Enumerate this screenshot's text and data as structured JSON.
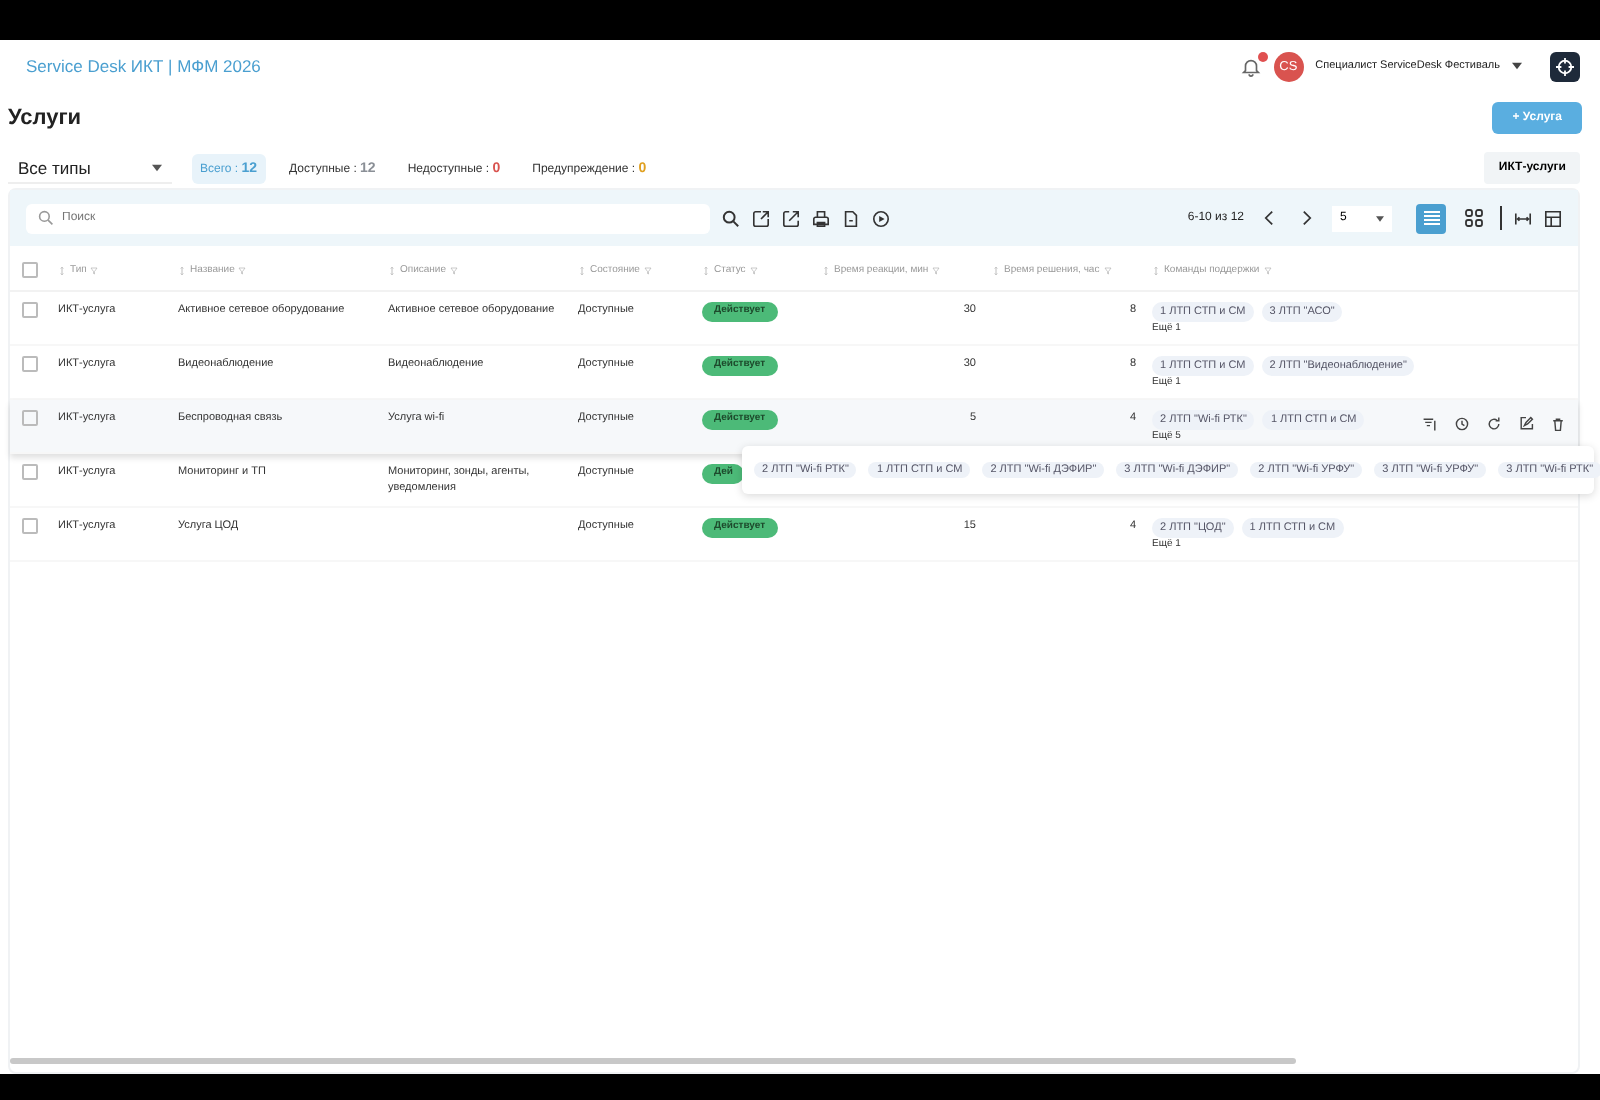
{
  "header": {
    "title": "Service Desk ИКТ | МФМ 2026",
    "notifications": {
      "unread": true
    },
    "user": {
      "initials": "CS",
      "name": "Специалист ServiceDesk Фестиваль"
    }
  },
  "page": {
    "title": "Услуги",
    "add_button": "+ Услуга"
  },
  "filters": {
    "type_select": "Все типы",
    "counters": [
      {
        "label": "Всего :",
        "value": "12",
        "selected": true,
        "color": "#4a9fd0"
      },
      {
        "label": "Доступные :",
        "value": "12",
        "selected": false,
        "color": "#8a8f96"
      },
      {
        "label": "Недоступные :",
        "value": "0",
        "selected": false,
        "color": "#d9534f"
      },
      {
        "label": "Предупреждение :",
        "value": "0",
        "selected": false,
        "color": "#e0a020"
      }
    ]
  },
  "side_tab": "ИКТ-услуги",
  "toolbar": {
    "search_placeholder": "Поиск",
    "range": "6-10 из 12",
    "page_size": "5",
    "views": [
      {
        "kind": "list",
        "selected": true
      },
      {
        "kind": "grid",
        "selected": false
      }
    ]
  },
  "select_all": {
    "checked": false
  },
  "columns": [
    "Тип",
    "Название",
    "Описание",
    "Состояние",
    "Статус",
    "Время реакции, мин",
    "Время решения, час",
    "Команды поддержки"
  ],
  "rows": [
    {
      "checked": false,
      "highlighted": false,
      "type": "ИКТ-услуга",
      "name": "Активное сетевое оборудование",
      "description": "Активное сетевое оборудование",
      "state": "Доступные",
      "status": "Действует",
      "reaction": "30",
      "resolution": "8",
      "teams": [
        "1 ЛТП СТП и СМ",
        "3 ЛТП \"АСО\""
      ],
      "more": "Ещё 1"
    },
    {
      "checked": false,
      "highlighted": false,
      "type": "ИКТ-услуга",
      "name": "Видеонаблюдение",
      "description": "Видеонаблюдение",
      "state": "Доступные",
      "status": "Действует",
      "reaction": "30",
      "resolution": "8",
      "teams": [
        "1 ЛТП СТП и СМ",
        "2 ЛТП \"Видеонаблюдение\""
      ],
      "more": "Ещё 1"
    },
    {
      "checked": false,
      "highlighted": true,
      "type": "ИКТ-услуга",
      "name": "Беспроводная связь",
      "description": "Услуга wi-fi",
      "state": "Доступные",
      "status": "Действует",
      "reaction": "5",
      "resolution": "4",
      "teams": [
        "2 ЛТП \"Wi-fi РТК\"",
        "1 ЛТП СТП и СМ"
      ],
      "more": "Ещё 5"
    },
    {
      "checked": false,
      "highlighted": false,
      "type": "ИКТ-услуга",
      "name": "Мониторинг и ТП",
      "description": "Мониторинг, зонды, агенты, уведомления",
      "state": "Доступные",
      "status": "Дей"
    },
    {
      "checked": false,
      "highlighted": false,
      "type": "ИКТ-услуга",
      "name": "Услуга ЦОД",
      "state": "Доступные",
      "status": "Действует",
      "reaction": "15",
      "resolution": "4",
      "teams": [
        "2 ЛТП \"ЦОД\"",
        "1 ЛТП СТП и СМ"
      ],
      "more": "Ещё 1"
    }
  ],
  "popup": {
    "tags": [
      "2 ЛТП \"Wi-fi РТК\"",
      "1 ЛТП СТП и СМ",
      "2 ЛТП \"Wi-fi ДЭФИР\"",
      "3 ЛТП \"Wi-fi ДЭФИР\"",
      "2 ЛТП \"Wi-fi УРФУ\"",
      "3 ЛТП \"Wi-fi УРФУ\"",
      "3 ЛТП \"Wi-fi РТК\""
    ]
  }
}
